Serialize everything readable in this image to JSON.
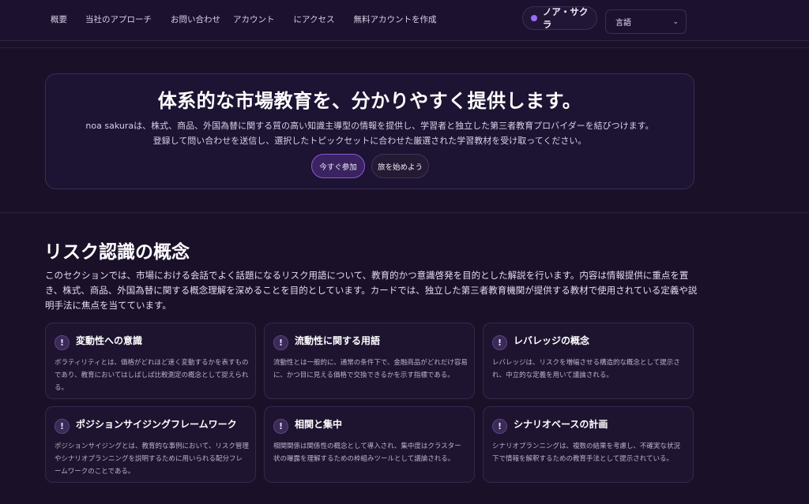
{
  "nav": {
    "items": [
      "概要",
      "当社のアプローチ",
      "お問い合わせ",
      "アカウント",
      "にアクセス",
      "無料アカウントを作成"
    ]
  },
  "user": {
    "name": "ノア・サクラ"
  },
  "language": {
    "selected": "言語"
  },
  "hero": {
    "title": "体系的な市場教育を、分かりやすく提供します。",
    "line1": "noa sakuraは、株式、商品、外国為替に関する質の高い知識主導型の情報を提供し、学習者と独立した第三者教育プロバイダーを結びつけます。",
    "line2": "登録して問い合わせを送信し、選択したトピックセットに合わせた厳選された学習教材を受け取ってください。",
    "primary_button": "今すぐ参加",
    "secondary_button": "旅を始めよう"
  },
  "section": {
    "title": "リスク認識の概念",
    "description": "このセクションでは、市場における会話でよく話題になるリスク用語について、教育的かつ意識啓発を目的とした解説を行います。内容は情報提供に重点を置き、株式、商品、外国為替に関する概念理解を深めることを目的としています。カードでは、独立した第三者教育機関が提供する教材で使用されている定義や説明手法に焦点を当てています。"
  },
  "cards": [
    {
      "badge": "!",
      "title": "変動性への意識",
      "body": "ボラティリティとは、価格がどれほど速く変動するかを表すものであり、教育においてはしばしば比較測定の概念として捉えられる。"
    },
    {
      "badge": "!",
      "title": "流動性に関する用語",
      "body": "流動性とは一般的に、通常の条件下で、金融商品がどれだけ容易に、かつ目に見える価格で交換できるかを示す指標である。"
    },
    {
      "badge": "!",
      "title": "レバレッジの概念",
      "body": "レバレッジは、リスクを増幅させる構造的な概念として提示され、中立的な定義を用いて議論される。"
    },
    {
      "badge": "!",
      "title": "ポジションサイジングフレームワーク",
      "body": "ポジションサイジングとは、教育的な事例において、リスク管理やシナリオプランニングを説明するために用いられる配分フレームワークのことである。"
    },
    {
      "badge": "!",
      "title": "相関と集中",
      "body": "相関関係は関係性の概念として導入され、集中度はクラスター状の曝露を理解するための枠組みツールとして議論される。"
    },
    {
      "badge": "!",
      "title": "シナリオベースの計画",
      "body": "シナリオプランニングは、複数の結果を考慮し、不確実な状況下で情報を解釈するための教育手法として提示されている。"
    }
  ]
}
